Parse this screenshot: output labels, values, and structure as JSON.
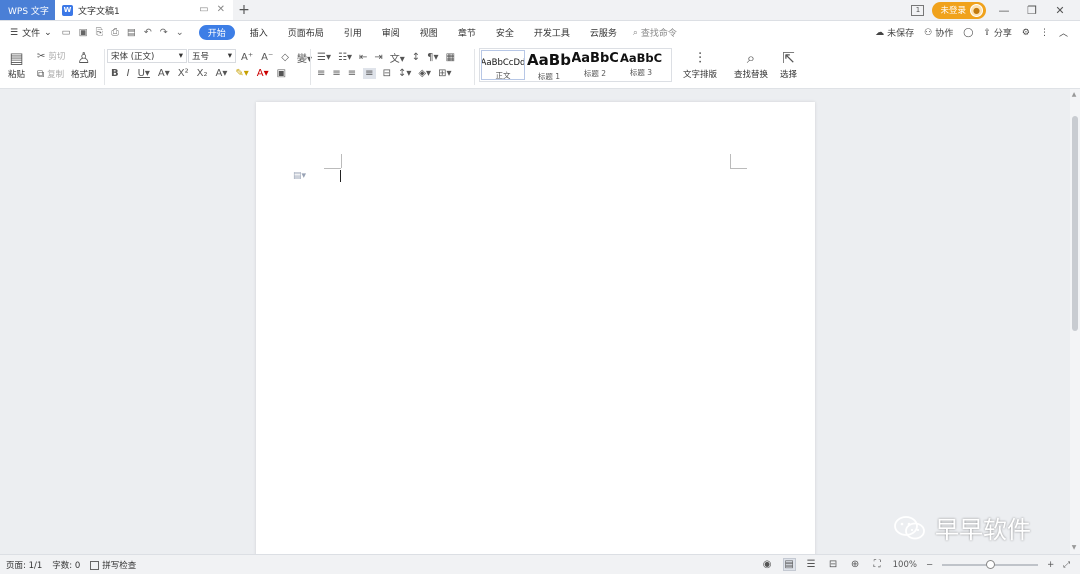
{
  "titlebar": {
    "app_tab": "WPS 文字",
    "doc_tab": "文字文稿1",
    "new_tab": "+",
    "page_badge": "1",
    "login": "未登录"
  },
  "menubar": {
    "file": "文件",
    "tabs": [
      "开始",
      "插入",
      "页面布局",
      "引用",
      "审阅",
      "视图",
      "章节",
      "安全",
      "开发工具",
      "云服务"
    ],
    "active_tab": "开始",
    "search": "查找命令",
    "unsaved": "未保存",
    "collab": "协作",
    "share": "分享"
  },
  "ribbon": {
    "paste": "粘贴",
    "cut": "剪切",
    "copy": "复制",
    "format_painter": "格式刷",
    "font_name": "宋体 (正文)",
    "font_size": "五号",
    "styles": [
      {
        "preview": "AaBbCcDd",
        "label": "正文"
      },
      {
        "preview": "AaBb",
        "label": "标题 1"
      },
      {
        "preview": "AaBbC",
        "label": "标题 2"
      },
      {
        "preview": "AaBbC",
        "label": "标题 3"
      }
    ],
    "text_layout": "文字排版",
    "find_replace": "查找替换",
    "select": "选择"
  },
  "watermark": {
    "text": "早早软件"
  },
  "statusbar": {
    "page": "页面: 1/1",
    "words": "字数: 0",
    "spellcheck": "拼写检查",
    "zoom": "100%",
    "zoom_fraction": 0.5
  },
  "colors": {
    "accent": "#3d7ee6",
    "app_tab": "#4a7fd6",
    "login": "#f0a21c"
  }
}
